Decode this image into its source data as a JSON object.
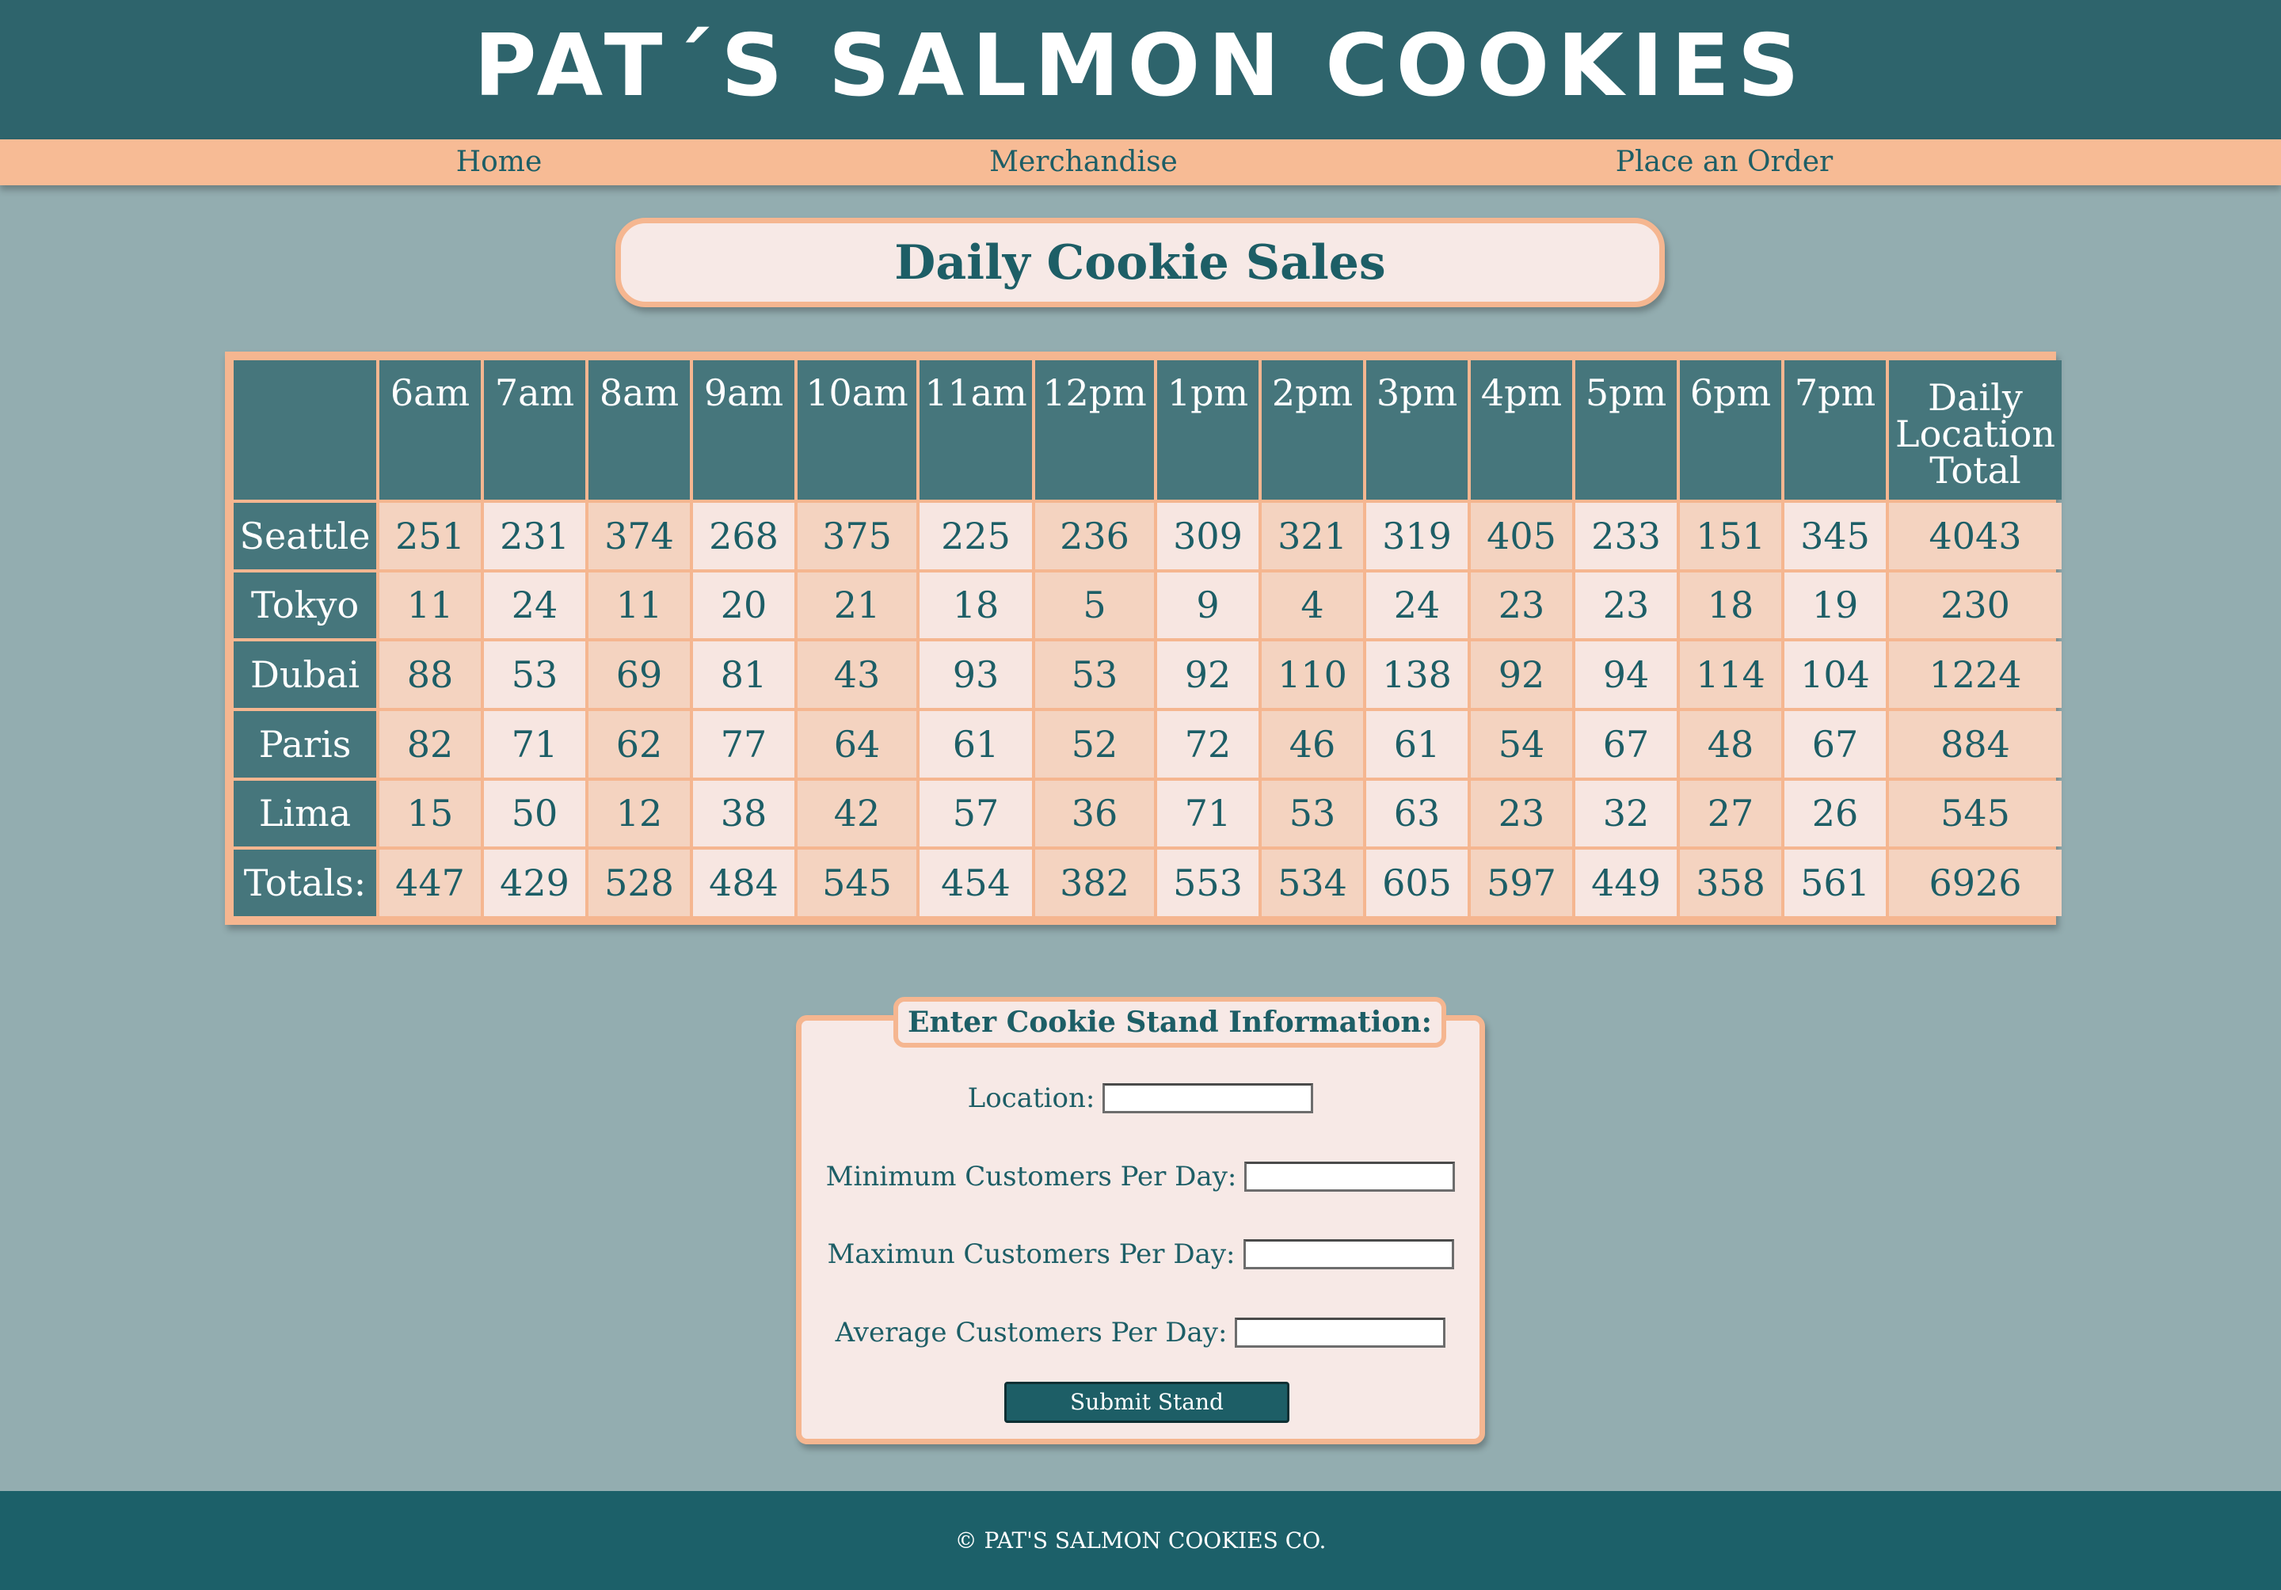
{
  "header": {
    "title": "PAT´S SALMON COOKIES"
  },
  "nav": {
    "items": [
      {
        "label": "Home"
      },
      {
        "label": "Merchandise"
      },
      {
        "label": "Place an Order"
      }
    ]
  },
  "page_title": "Daily Cookie Sales",
  "sales_table": {
    "columns": [
      "6am",
      "7am",
      "8am",
      "9am",
      "10am",
      "11am",
      "12pm",
      "1pm",
      "2pm",
      "3pm",
      "4pm",
      "5pm",
      "6pm",
      "7pm"
    ],
    "total_header": [
      "Daily",
      "Location",
      "Total"
    ],
    "rows": [
      {
        "location": "Seattle",
        "values": [
          "251",
          "231",
          "374",
          "268",
          "375",
          "225",
          "236",
          "309",
          "321",
          "319",
          "405",
          "233",
          "151",
          "345"
        ],
        "total": "4043"
      },
      {
        "location": "Tokyo",
        "values": [
          "11",
          "24",
          "11",
          "20",
          "21",
          "18",
          "5",
          "9",
          "4",
          "24",
          "23",
          "23",
          "18",
          "19"
        ],
        "total": "230"
      },
      {
        "location": "Dubai",
        "values": [
          "88",
          "53",
          "69",
          "81",
          "43",
          "93",
          "53",
          "92",
          "110",
          "138",
          "92",
          "94",
          "114",
          "104"
        ],
        "total": "1224"
      },
      {
        "location": "Paris",
        "values": [
          "82",
          "71",
          "62",
          "77",
          "64",
          "61",
          "52",
          "72",
          "46",
          "61",
          "54",
          "67",
          "48",
          "67"
        ],
        "total": "884"
      },
      {
        "location": "Lima",
        "values": [
          "15",
          "50",
          "12",
          "38",
          "42",
          "57",
          "36",
          "71",
          "53",
          "63",
          "23",
          "32",
          "27",
          "26"
        ],
        "total": "545"
      }
    ],
    "totals": {
      "label": "Totals:",
      "values": [
        "447",
        "429",
        "528",
        "484",
        "545",
        "454",
        "382",
        "553",
        "534",
        "605",
        "597",
        "449",
        "358",
        "561"
      ],
      "total": "6926"
    }
  },
  "form": {
    "legend": "Enter Cookie Stand Information:",
    "location_label": "Location:",
    "location_value": "",
    "min_label": "Minimum Customers Per Day:",
    "min_value": "",
    "max_label": "Maximun Customers Per Day:",
    "max_value": "",
    "avg_label": "Average Customers Per Day:",
    "avg_value": "",
    "submit_label": "Submit Stand"
  },
  "footer": {
    "text": "© PAT'S SALMON COOKIES CO."
  },
  "colors": {
    "header_bg": "#2e646c",
    "nav_bg": "#f7bb95",
    "page_bg": "#93adb0",
    "accent_text": "#1d5e66",
    "table_header_bg": "#46767c",
    "cell_dark": "#f4d3c0",
    "cell_light": "#f7e6e1",
    "footer_bg": "#1c6069"
  }
}
